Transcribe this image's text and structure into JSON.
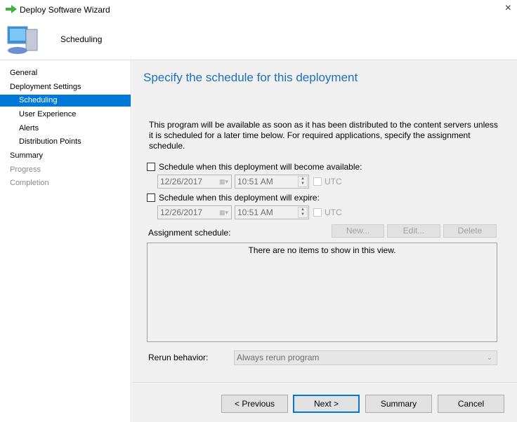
{
  "window": {
    "title": "Deploy Software Wizard",
    "close_icon": "×"
  },
  "header": {
    "title": "Scheduling"
  },
  "sidebar": {
    "items": [
      {
        "label": "General"
      },
      {
        "label": "Deployment Settings"
      },
      {
        "label": "Scheduling"
      },
      {
        "label": "User Experience"
      },
      {
        "label": "Alerts"
      },
      {
        "label": "Distribution Points"
      },
      {
        "label": "Summary"
      },
      {
        "label": "Progress"
      },
      {
        "label": "Completion"
      }
    ]
  },
  "main": {
    "heading": "Specify the schedule for this deployment",
    "description": "This program will be available as soon as it has been distributed to the content servers unless it is scheduled for a later time below. For required applications, specify the assignment schedule.",
    "available": {
      "label": "Schedule when this deployment will become available:",
      "date": "12/26/2017",
      "time": "10:51 AM",
      "utc": "UTC"
    },
    "expire": {
      "label": "Schedule when this deployment will expire:",
      "date": "12/26/2017",
      "time": "10:51 AM",
      "utc": "UTC"
    },
    "assignment_label": "Assignment schedule:",
    "new_label": "New...",
    "edit_label": "Edit...",
    "delete_label": "Delete",
    "empty_text": "There are no items to show in this view.",
    "rerun_label": "Rerun behavior:",
    "rerun_value": "Always rerun program"
  },
  "footer": {
    "previous": "< Previous",
    "next": "Next >",
    "summary": "Summary",
    "cancel": "Cancel"
  }
}
